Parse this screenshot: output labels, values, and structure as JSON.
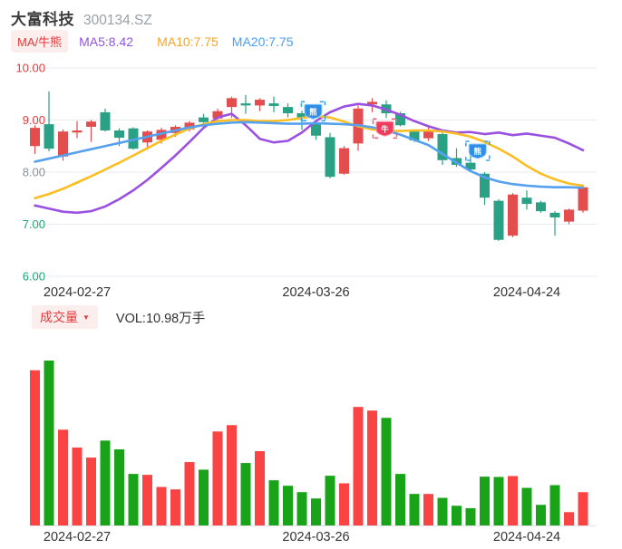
{
  "header": {
    "title": "大富科技",
    "code": "300134.SZ"
  },
  "legend": {
    "indicator_label": "MA/牛熊",
    "ma5": "MA5:8.42",
    "ma10": "MA10:7.75",
    "ma20": "MA20:7.75"
  },
  "volume_header": {
    "label": "成交量",
    "arrow": "▼",
    "vol": "VOL:10.98万手"
  },
  "colors": {
    "candle_up": "#e34d4d",
    "candle_down": "#2aa184",
    "volume_up": "#fa4343",
    "volume_down": "#19a319",
    "ma5_line": "#9b51e0",
    "ma10_line": "#fbbe23",
    "ma20_line": "#55a0ef",
    "grid": "#e7ebf2",
    "tick_red": "#e23c3c",
    "tick_gray": "#8a8f99",
    "tick_green": "#1ea672",
    "date_text": "#333333",
    "bull_marker": "#ee3b5e",
    "bear_marker": "#2f8fe8"
  },
  "chart_data": [
    {
      "type": "candlestick",
      "title": "price pane",
      "ylim": [
        6.0,
        10.0
      ],
      "grid": true,
      "y_ticks": [
        {
          "label": "10.00",
          "value": 10.0,
          "color": "#e23c3c"
        },
        {
          "label": "9.00",
          "value": 9.0,
          "color": "#e23c3c"
        },
        {
          "label": "8.00",
          "value": 8.0,
          "color": "#8a8f99"
        },
        {
          "label": "7.00",
          "value": 7.0,
          "color": "#1ea672"
        },
        {
          "label": "6.00",
          "value": 6.0,
          "color": "#1ea672"
        }
      ],
      "x_ticks": [
        {
          "label": "2024-02-27",
          "index": 3
        },
        {
          "label": "2024-03-26",
          "index": 20
        },
        {
          "label": "2024-04-24",
          "index": 35
        }
      ],
      "candles": [
        [
          8.5,
          8.9,
          8.35,
          8.85
        ],
        [
          8.92,
          9.55,
          8.4,
          8.45
        ],
        [
          8.3,
          8.82,
          8.22,
          8.78
        ],
        [
          8.76,
          8.98,
          8.65,
          8.8
        ],
        [
          8.87,
          9.0,
          8.58,
          8.97
        ],
        [
          9.15,
          9.22,
          8.78,
          8.8
        ],
        [
          8.8,
          8.84,
          8.5,
          8.66
        ],
        [
          8.84,
          8.86,
          8.43,
          8.45
        ],
        [
          8.57,
          8.8,
          8.43,
          8.78
        ],
        [
          8.62,
          8.85,
          8.55,
          8.81
        ],
        [
          8.75,
          8.9,
          8.68,
          8.87
        ],
        [
          8.82,
          8.98,
          8.78,
          8.95
        ],
        [
          9.05,
          9.12,
          8.88,
          8.96
        ],
        [
          9.03,
          9.22,
          8.98,
          9.17
        ],
        [
          9.25,
          9.45,
          9.04,
          9.42
        ],
        [
          9.32,
          9.48,
          9.12,
          9.28
        ],
        [
          9.28,
          9.42,
          9.17,
          9.39
        ],
        [
          9.32,
          9.45,
          9.15,
          9.27
        ],
        [
          9.25,
          9.32,
          9.05,
          9.13
        ],
        [
          9.13,
          9.18,
          8.81,
          9.04
        ],
        [
          8.95,
          9.0,
          8.62,
          8.7
        ],
        [
          8.67,
          8.75,
          7.88,
          7.91
        ],
        [
          7.97,
          8.5,
          7.95,
          8.46
        ],
        [
          8.55,
          9.28,
          8.41,
          9.22
        ],
        [
          9.3,
          9.42,
          9.15,
          9.35
        ],
        [
          9.3,
          9.38,
          9.04,
          9.13
        ],
        [
          9.13,
          9.16,
          8.88,
          8.9
        ],
        [
          8.78,
          8.82,
          8.58,
          8.61
        ],
        [
          8.65,
          8.88,
          8.6,
          8.78
        ],
        [
          8.73,
          8.76,
          8.14,
          8.23
        ],
        [
          8.27,
          8.46,
          8.1,
          8.14
        ],
        [
          8.18,
          8.35,
          8.02,
          8.05
        ],
        [
          7.97,
          8.0,
          7.37,
          7.51
        ],
        [
          7.45,
          7.48,
          6.68,
          6.7
        ],
        [
          6.78,
          7.6,
          6.75,
          7.57
        ],
        [
          7.51,
          7.65,
          7.28,
          7.39
        ],
        [
          7.42,
          7.45,
          7.22,
          7.25
        ],
        [
          7.22,
          7.25,
          6.78,
          7.13
        ],
        [
          7.05,
          7.3,
          7.0,
          7.28
        ],
        [
          7.26,
          7.74,
          7.22,
          7.71
        ]
      ],
      "series": [
        {
          "name": "MA5",
          "color": "#9b51e0",
          "values": [
            7.36,
            7.3,
            7.24,
            7.22,
            7.25,
            7.34,
            7.48,
            7.65,
            7.85,
            8.08,
            8.32,
            8.58,
            8.85,
            9.05,
            9.12,
            8.9,
            8.64,
            8.57,
            8.6,
            8.76,
            8.98,
            9.15,
            9.26,
            9.31,
            9.28,
            9.2,
            9.1,
            8.98,
            8.88,
            8.8,
            8.76,
            8.77,
            8.73,
            8.76,
            8.71,
            8.74,
            8.7,
            8.66,
            8.55,
            8.42
          ]
        },
        {
          "name": "MA10",
          "color": "#fbbe23",
          "values": [
            7.5,
            7.58,
            7.68,
            7.8,
            7.92,
            8.05,
            8.18,
            8.32,
            8.46,
            8.6,
            8.72,
            8.84,
            8.92,
            8.98,
            9.0,
            9.0,
            8.98,
            8.98,
            9.0,
            9.04,
            9.08,
            9.05,
            8.97,
            8.88,
            8.82,
            8.79,
            8.79,
            8.8,
            8.8,
            8.78,
            8.74,
            8.68,
            8.58,
            8.45,
            8.3,
            8.12,
            7.97,
            7.86,
            7.78,
            7.74
          ]
        },
        {
          "name": "MA20",
          "color": "#55a0ef",
          "values": [
            8.2,
            8.26,
            8.32,
            8.38,
            8.44,
            8.5,
            8.56,
            8.62,
            8.68,
            8.74,
            8.8,
            8.86,
            8.9,
            8.93,
            8.95,
            8.96,
            8.95,
            8.94,
            8.93,
            8.93,
            8.94,
            8.93,
            8.92,
            8.9,
            8.86,
            8.8,
            8.72,
            8.62,
            8.52,
            8.35,
            8.18,
            8.02,
            7.9,
            7.82,
            7.77,
            7.74,
            7.72,
            7.71,
            7.71,
            7.7
          ]
        }
      ],
      "markers": [
        {
          "type": "bear",
          "glyph": "熊",
          "index": 19.8,
          "value": 9.16
        },
        {
          "type": "bull",
          "glyph": "牛",
          "index": 24.9,
          "value": 8.83
        },
        {
          "type": "bear",
          "glyph": "熊",
          "index": 31.5,
          "value": 8.4
        }
      ]
    },
    {
      "type": "bar",
      "title": "volume pane (万手)",
      "ylim": [
        0,
        58
      ],
      "values": [
        51.2,
        54.4,
        31.6,
        25.7,
        22.4,
        28.0,
        25.1,
        17.0,
        16.7,
        12.7,
        11.9,
        20.9,
        18.4,
        31.0,
        33.1,
        20.6,
        24.5,
        14.9,
        13.1,
        11.0,
        8.9,
        16.4,
        13.9,
        39.1,
        37.9,
        35.5,
        17.0,
        10.4,
        10.4,
        9.1,
        6.5,
        5.7,
        16.1,
        16.0,
        16.3,
        12.4,
        6.8,
        13.3,
        4.4,
        10.98
      ],
      "x_ticks": [
        {
          "label": "2024-02-27",
          "index": 3
        },
        {
          "label": "2024-03-26",
          "index": 20
        },
        {
          "label": "2024-04-24",
          "index": 35
        }
      ]
    }
  ]
}
